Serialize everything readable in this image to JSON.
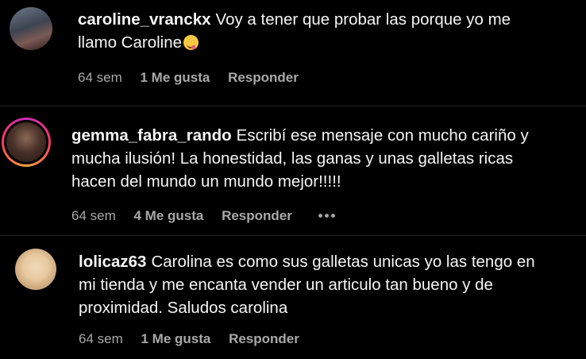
{
  "comments": [
    {
      "username": "caroline_vranckx",
      "text_line1": "Voy a tener que probar las porque yo me",
      "text_line2": "llamo Caroline",
      "emoji": "yum-face-icon",
      "age": "64 sem",
      "likes": "1 Me gusta",
      "reply": "Responder"
    },
    {
      "username": "gemma_fabra_rando",
      "text_line1": "Escribí ese mensaje con mucho cariño y",
      "text_line2": "mucha ilusión! La honestidad, las ganas y unas galletas ricas",
      "text_line3": "hacen del mundo un mundo mejor!!!!!",
      "age": "64 sem",
      "likes": "4 Me gusta",
      "reply": "Responder",
      "more": "•••"
    },
    {
      "username": "lolicaz63",
      "text_line1": "Carolina es como sus galletas unicas yo las tengo en",
      "text_line2": "mi tienda y me encanta vender un articulo tan bueno y de",
      "text_line3": "proximidad. Saludos carolina",
      "age": "64 sem",
      "likes": "1 Me gusta",
      "reply": "Responder"
    }
  ]
}
